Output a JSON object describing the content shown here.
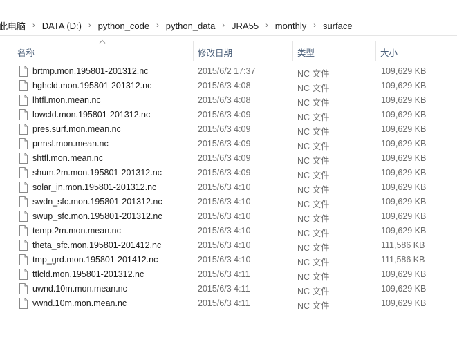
{
  "breadcrumb": [
    "此电脑",
    "DATA (D:)",
    "python_code",
    "python_data",
    "JRA55",
    "monthly",
    "surface"
  ],
  "columns": {
    "name": "名称",
    "date": "修改日期",
    "type": "类型",
    "size": "大小"
  },
  "files": [
    {
      "name": "brtmp.mon.195801-201312.nc",
      "date": "2015/6/2 17:37",
      "type": "NC 文件",
      "size": "109,629 KB"
    },
    {
      "name": "hghcld.mon.195801-201312.nc",
      "date": "2015/6/3 4:08",
      "type": "NC 文件",
      "size": "109,629 KB"
    },
    {
      "name": "lhtfl.mon.mean.nc",
      "date": "2015/6/3 4:08",
      "type": "NC 文件",
      "size": "109,629 KB"
    },
    {
      "name": "lowcld.mon.195801-201312.nc",
      "date": "2015/6/3 4:09",
      "type": "NC 文件",
      "size": "109,629 KB"
    },
    {
      "name": "pres.surf.mon.mean.nc",
      "date": "2015/6/3 4:09",
      "type": "NC 文件",
      "size": "109,629 KB"
    },
    {
      "name": "prmsl.mon.mean.nc",
      "date": "2015/6/3 4:09",
      "type": "NC 文件",
      "size": "109,629 KB"
    },
    {
      "name": "shtfl.mon.mean.nc",
      "date": "2015/6/3 4:09",
      "type": "NC 文件",
      "size": "109,629 KB"
    },
    {
      "name": "shum.2m.mon.195801-201312.nc",
      "date": "2015/6/3 4:09",
      "type": "NC 文件",
      "size": "109,629 KB"
    },
    {
      "name": "solar_in.mon.195801-201312.nc",
      "date": "2015/6/3 4:10",
      "type": "NC 文件",
      "size": "109,629 KB"
    },
    {
      "name": "swdn_sfc.mon.195801-201312.nc",
      "date": "2015/6/3 4:10",
      "type": "NC 文件",
      "size": "109,629 KB"
    },
    {
      "name": "swup_sfc.mon.195801-201312.nc",
      "date": "2015/6/3 4:10",
      "type": "NC 文件",
      "size": "109,629 KB"
    },
    {
      "name": "temp.2m.mon.mean.nc",
      "date": "2015/6/3 4:10",
      "type": "NC 文件",
      "size": "109,629 KB"
    },
    {
      "name": "theta_sfc.mon.195801-201412.nc",
      "date": "2015/6/3 4:10",
      "type": "NC 文件",
      "size": "111,586 KB"
    },
    {
      "name": "tmp_grd.mon.195801-201412.nc",
      "date": "2015/6/3 4:10",
      "type": "NC 文件",
      "size": "111,586 KB"
    },
    {
      "name": "ttlcld.mon.195801-201312.nc",
      "date": "2015/6/3 4:11",
      "type": "NC 文件",
      "size": "109,629 KB"
    },
    {
      "name": "uwnd.10m.mon.mean.nc",
      "date": "2015/6/3 4:11",
      "type": "NC 文件",
      "size": "109,629 KB"
    },
    {
      "name": "vwnd.10m.mon.mean.nc",
      "date": "2015/6/3 4:11",
      "type": "NC 文件",
      "size": "109,629 KB"
    }
  ],
  "colors": {
    "header_text": "#4c607a",
    "muted_text": "#6d6d6d",
    "divider": "#e5e5e5"
  },
  "icons": {
    "separator": "chevron-right-icon",
    "sort": "sort-ascending-icon",
    "file": "file-icon"
  }
}
